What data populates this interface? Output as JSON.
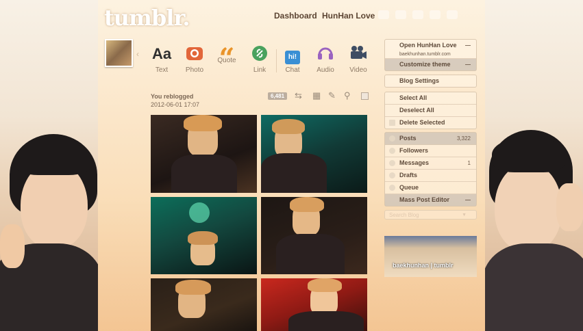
{
  "app": {
    "logo": "tumblr."
  },
  "nav": {
    "dashboard": "Dashboard",
    "blog": "HunHan Love"
  },
  "composer": {
    "types": [
      {
        "icon": "Aa",
        "label": "Text"
      },
      {
        "icon": "camera-icon",
        "label": "Photo"
      },
      {
        "icon": "“",
        "label": "Quote"
      },
      {
        "icon": "link-icon",
        "label": "Link"
      },
      {
        "icon": "hi!",
        "label": "Chat"
      },
      {
        "icon": "headphones-icon",
        "label": "Audio"
      },
      {
        "icon": "video-camera-icon",
        "label": "Video"
      }
    ]
  },
  "post": {
    "status": "You reblogged",
    "date": "2012-06-01 17:07",
    "notes": "6,481"
  },
  "sidebar": {
    "blog": {
      "title": "Open HunHan Love",
      "url": "baekhunhan.tumblr.com",
      "customize": "Customize theme"
    },
    "settings": "Blog Settings",
    "mass": {
      "select_all": "Select All",
      "deselect_all": "Deselect All",
      "delete": "Delete Selected"
    },
    "stats": {
      "posts": {
        "label": "Posts",
        "count": "3,322"
      },
      "followers": {
        "label": "Followers"
      },
      "messages": {
        "label": "Messages",
        "count": "1"
      },
      "drafts": {
        "label": "Drafts"
      },
      "queue": {
        "label": "Queue"
      },
      "editor": {
        "label": "Mass Post Editor"
      }
    },
    "search_placeholder": "Search Blog",
    "banner_caption": "baekhunhan | tumblr"
  },
  "colors": {
    "text_icon": "#2f2f2f",
    "photo_icon": "#e2663a",
    "quote_icon": "#e9942a",
    "link_icon": "#4aa25e",
    "chat_icon": "#3a8fd4",
    "audio_icon": "#9a63c0",
    "video_icon": "#3e4d63"
  }
}
